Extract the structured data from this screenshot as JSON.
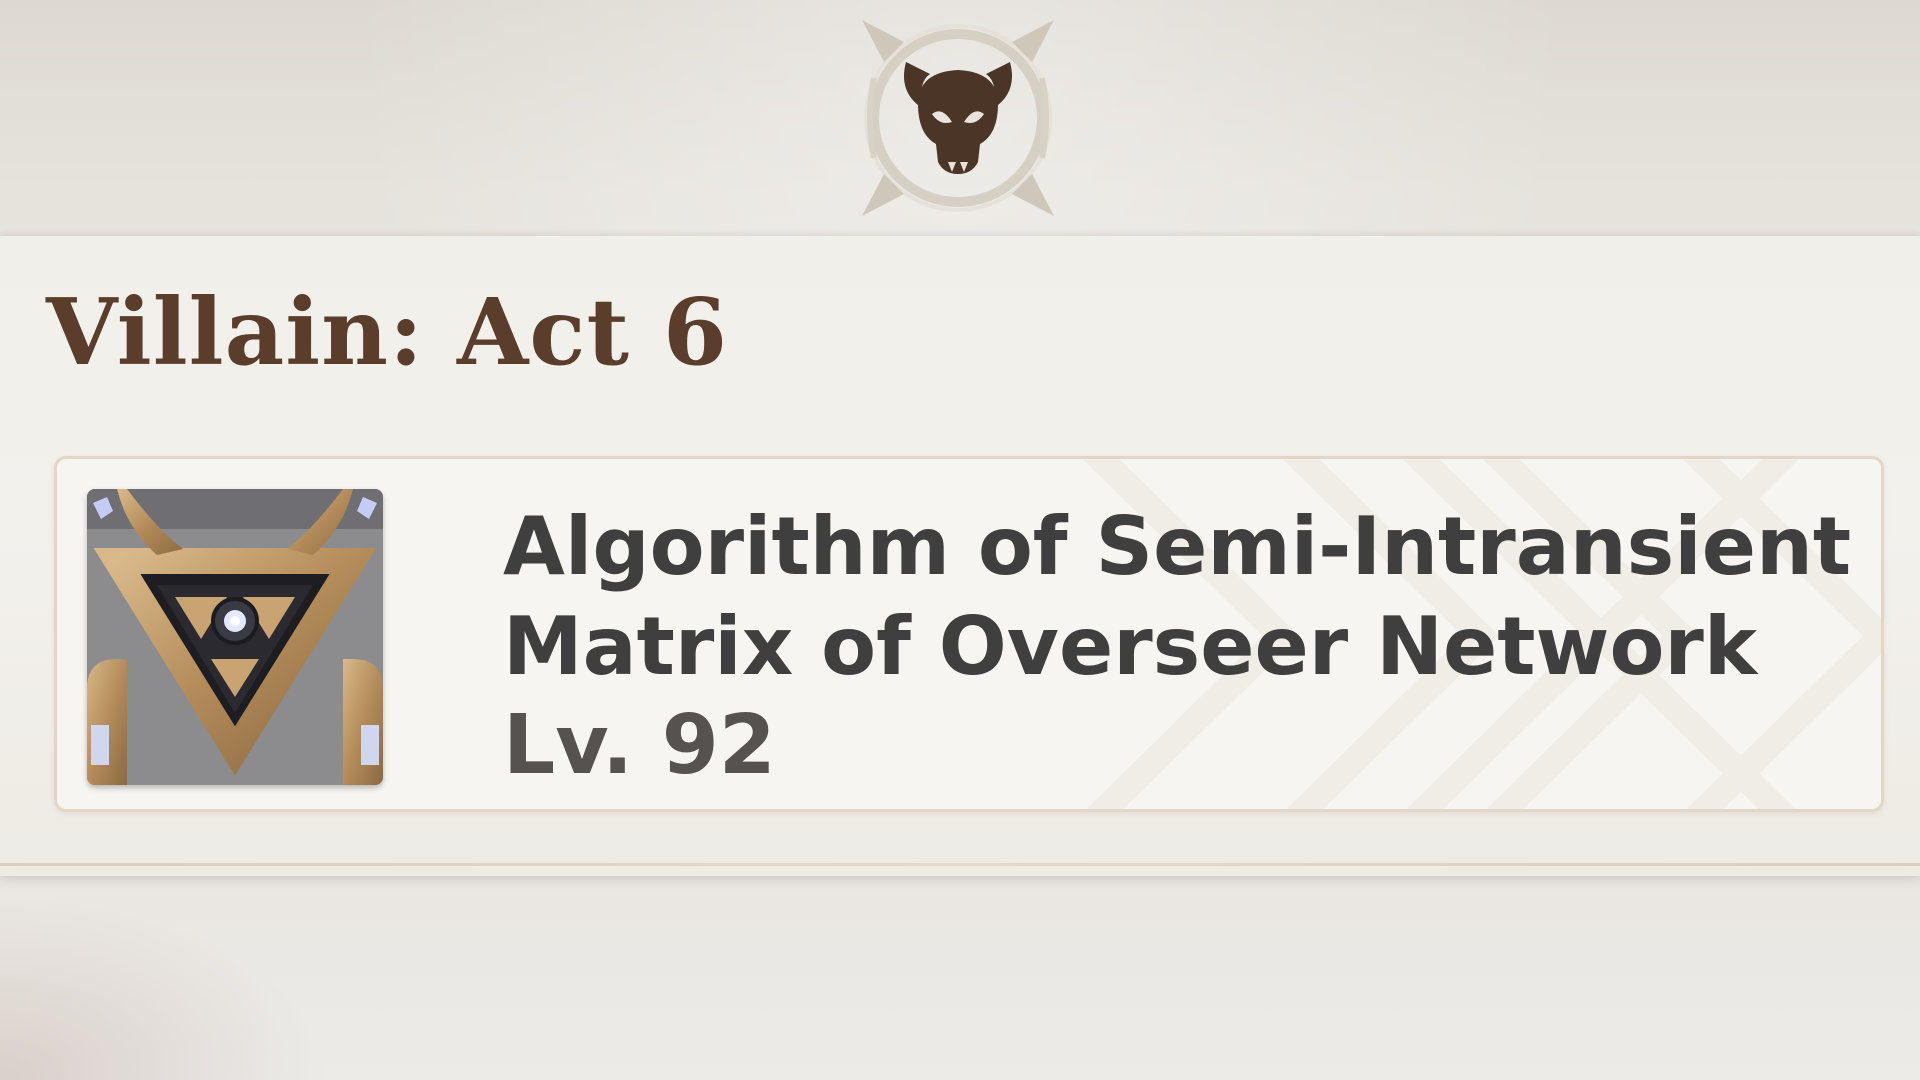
{
  "header": {
    "emblem_icon": "villain-skull-icon"
  },
  "banner": {
    "title": "Villain: Act 6"
  },
  "enemy": {
    "portrait_icon": "mechanical-construct-portrait",
    "name_line1": "Algorithm of Semi-Intransient",
    "name_line2": "Matrix of Overseer Network",
    "level": "Lv. 92"
  },
  "colors": {
    "title": "#5a3d2b",
    "name_text": "#3f3f3f",
    "level_text": "#555250",
    "emblem": "#4a3527",
    "card_border": "#e4d6c6"
  }
}
